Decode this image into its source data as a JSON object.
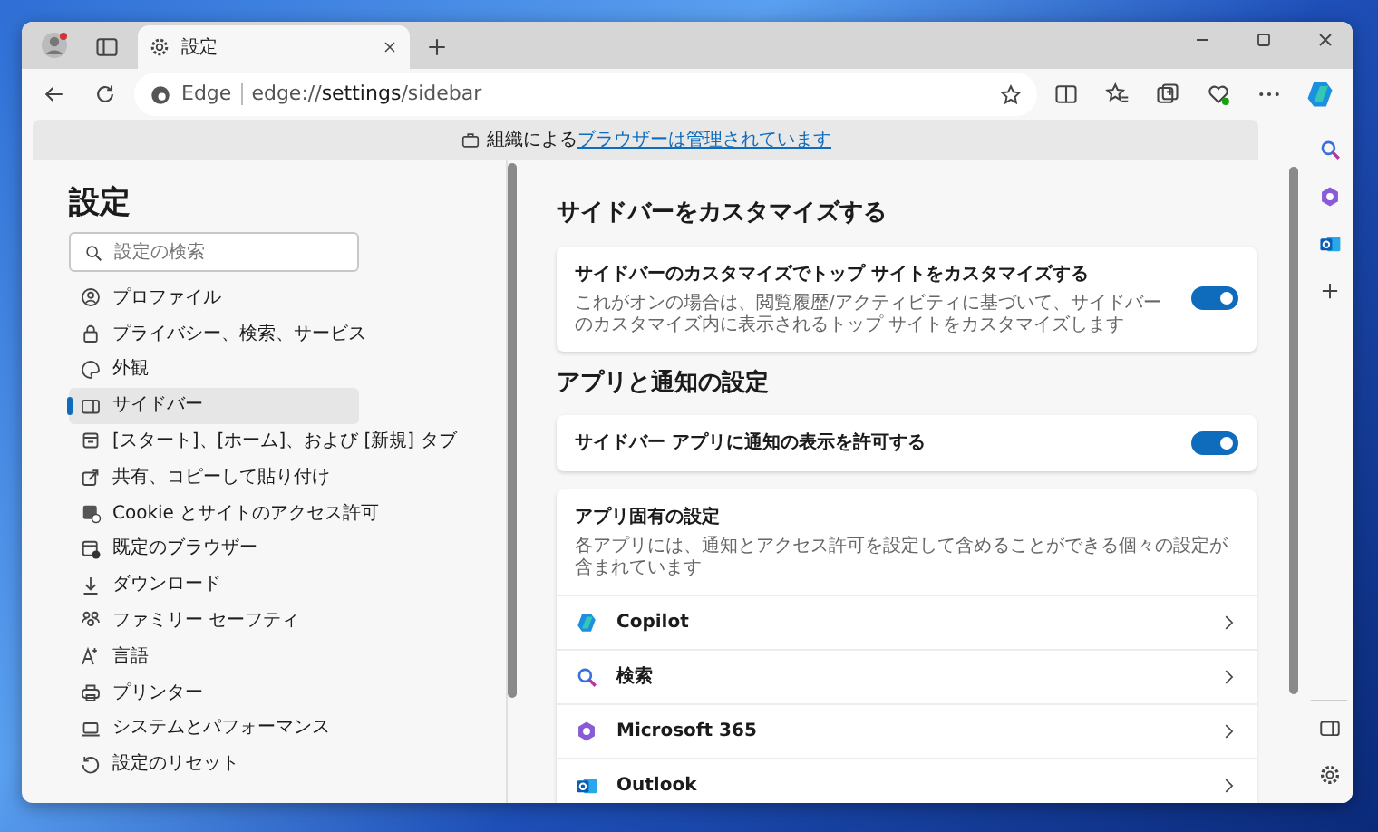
{
  "browser_tab": {
    "title": "設定",
    "selected": true
  },
  "address_bar": {
    "site_label": "Edge",
    "url": "edge://**settings**/sidebar"
  },
  "info_bar": {
    "text": "組織による",
    "link": "ブラウザーは管理されています"
  },
  "nav": {
    "title": "設定",
    "search": {
      "placeholder": "設定の検索"
    },
    "items": [
      {
        "label": "プロファイル",
        "selected": false
      },
      {
        "label": "プライバシー、検索、サービス",
        "selected": false
      },
      {
        "label": "外観",
        "selected": false
      },
      {
        "label": "サイドバー",
        "selected": true
      },
      {
        "label": "[スタート]、[ホーム]、および [新規] タブ",
        "selected": false
      },
      {
        "label": "共有、コピーして貼り付け",
        "selected": false
      },
      {
        "label": "Cookie とサイトのアクセス許可",
        "selected": false
      },
      {
        "label": "既定のブラウザー",
        "selected": false
      },
      {
        "label": "ダウンロード",
        "selected": false
      },
      {
        "label": "ファミリー セーフティ",
        "selected": false
      },
      {
        "label": "言語",
        "selected": false
      },
      {
        "label": "プリンター",
        "selected": false
      },
      {
        "label": "システムとパフォーマンス",
        "selected": false
      },
      {
        "label": "設定のリセット",
        "selected": false
      }
    ]
  },
  "sections": [
    {
      "heading": "サイドバーをカスタマイズする",
      "settings": [
        {
          "title": "サイドバーのカスタマイズでトップ サイトをカスタマイズする",
          "description": "これがオンの場合は、閲覧履歴/アクティビティに基づいて、サイドバーのカスタマイズ内に表示されるトップ サイトをカスタマイズします",
          "on": true
        }
      ]
    },
    {
      "heading": "アプリと通知の設定",
      "settings": [
        {
          "title": "サイドバー アプリに通知の表示を許可する",
          "on": true
        }
      ],
      "app_list": {
        "title": "アプリ固有の設定",
        "description": "各アプリには、通知とアクセス許可を設定して含めることができる個々の設定が含まれています",
        "apps": [
          {
            "name": "Copilot"
          },
          {
            "name": "検索"
          },
          {
            "name": "Microsoft 365"
          },
          {
            "name": "Outlook"
          }
        ]
      }
    }
  ]
}
